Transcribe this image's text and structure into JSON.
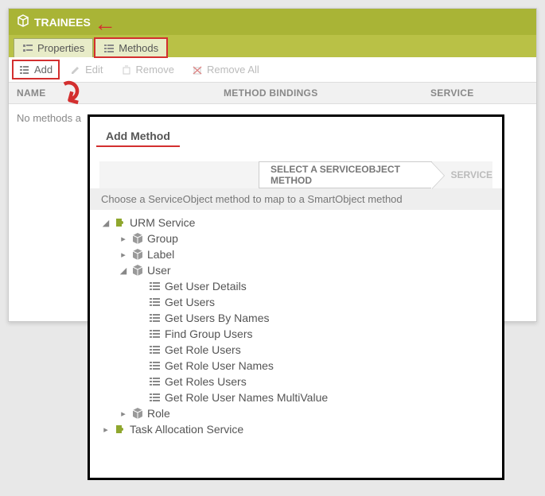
{
  "header": {
    "title": "TRAINEES"
  },
  "tabs": {
    "properties": "Properties",
    "methods": "Methods"
  },
  "toolbar": {
    "add": "Add",
    "edit": "Edit",
    "remove": "Remove",
    "remove_all": "Remove All"
  },
  "grid": {
    "columns": {
      "name": "NAME",
      "method": "METHOD BINDINGS",
      "service": "SERVICE"
    },
    "empty": "No methods a"
  },
  "dialog": {
    "title": "Add Method",
    "crumb_active": "SELECT A SERVICEOBJECT METHOD",
    "crumb_next": "SERVICE",
    "instruction": "Choose a ServiceObject method to map to a SmartObject method",
    "tree": {
      "urm": "URM Service",
      "group": "Group",
      "label": "Label",
      "user": "User",
      "methods": [
        "Get User Details",
        "Get Users",
        "Get Users By Names",
        "Find Group Users",
        "Get Role Users",
        "Get Role User Names",
        "Get Roles Users",
        "Get Role User Names MultiValue"
      ],
      "role": "Role",
      "task_alloc": "Task Allocation Service"
    }
  }
}
